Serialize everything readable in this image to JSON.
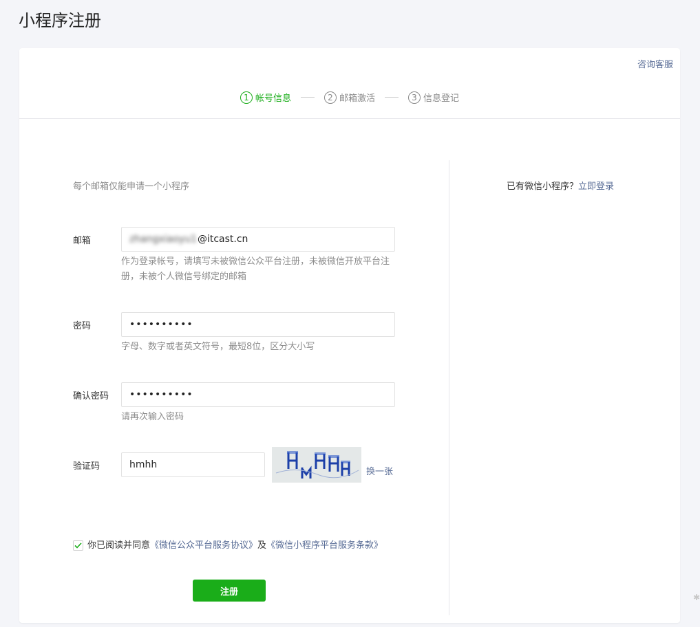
{
  "page": {
    "title": "小程序注册"
  },
  "header": {
    "consult": "咨询客服"
  },
  "steps": [
    {
      "num": "1",
      "label": "帐号信息"
    },
    {
      "num": "2",
      "label": "邮箱激活"
    },
    {
      "num": "3",
      "label": "信息登记"
    }
  ],
  "form": {
    "notice": "每个邮箱仅能申请一个小程序",
    "email": {
      "label": "邮箱",
      "value_visible": "@itcast.cn",
      "value_obscured": "zhangxiaoyu1",
      "hint": "作为登录帐号，请填写未被微信公众平台注册，未被微信开放平台注册，未被个人微信号绑定的邮箱"
    },
    "password": {
      "label": "密码",
      "value": "••••••••••",
      "hint": "字母、数字或者英文符号，最短8位，区分大小写"
    },
    "confirm": {
      "label": "确认密码",
      "value": "••••••••••",
      "hint": "请再次输入密码"
    },
    "captcha": {
      "label": "验证码",
      "value": "hmhh",
      "refresh": "换一张"
    },
    "agreement": {
      "prefix": "你已阅读并同意",
      "link1": "《微信公众平台服务协议》",
      "middle": "及",
      "link2": "《微信小程序平台服务条款》",
      "checked": true
    },
    "submit": "注册"
  },
  "side": {
    "text": "已有微信小程序？",
    "link": "立即登录"
  },
  "colors": {
    "primary": "#1aad19",
    "link": "#576b95"
  }
}
